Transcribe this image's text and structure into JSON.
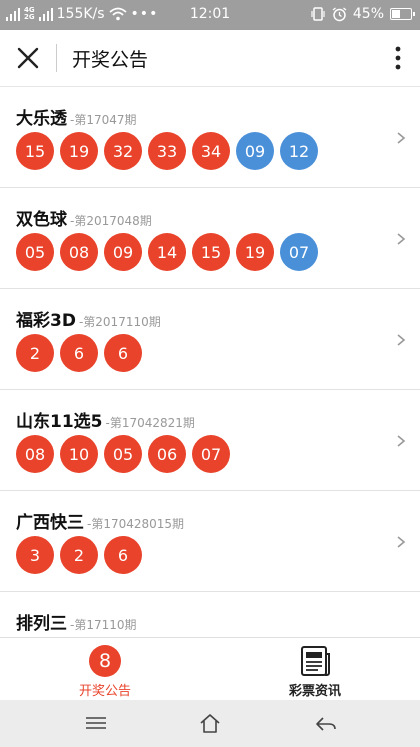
{
  "status_bar": {
    "network_top": "4G",
    "network_bottom": "2G",
    "speed": "155K/s",
    "time": "12:01",
    "battery": "45%",
    "battery_level": 0.45
  },
  "header": {
    "title": "开奖公告"
  },
  "lotteries": [
    {
      "name": "大乐透",
      "issue": "-第17047期",
      "balls": [
        {
          "n": "15",
          "c": "red"
        },
        {
          "n": "19",
          "c": "red"
        },
        {
          "n": "32",
          "c": "red"
        },
        {
          "n": "33",
          "c": "red"
        },
        {
          "n": "34",
          "c": "red"
        },
        {
          "n": "09",
          "c": "blue"
        },
        {
          "n": "12",
          "c": "blue"
        }
      ]
    },
    {
      "name": "双色球",
      "issue": "-第2017048期",
      "balls": [
        {
          "n": "05",
          "c": "red"
        },
        {
          "n": "08",
          "c": "red"
        },
        {
          "n": "09",
          "c": "red"
        },
        {
          "n": "14",
          "c": "red"
        },
        {
          "n": "15",
          "c": "red"
        },
        {
          "n": "19",
          "c": "red"
        },
        {
          "n": "07",
          "c": "blue"
        }
      ]
    },
    {
      "name": "福彩3D",
      "issue": "-第2017110期",
      "balls": [
        {
          "n": "2",
          "c": "red"
        },
        {
          "n": "6",
          "c": "red"
        },
        {
          "n": "6",
          "c": "red"
        }
      ]
    },
    {
      "name": "山东11选5",
      "issue": "-第17042821期",
      "balls": [
        {
          "n": "08",
          "c": "red"
        },
        {
          "n": "10",
          "c": "red"
        },
        {
          "n": "05",
          "c": "red"
        },
        {
          "n": "06",
          "c": "red"
        },
        {
          "n": "07",
          "c": "red"
        }
      ]
    },
    {
      "name": "广西快三",
      "issue": "-第170428015期",
      "balls": [
        {
          "n": "3",
          "c": "red"
        },
        {
          "n": "2",
          "c": "red"
        },
        {
          "n": "6",
          "c": "red"
        }
      ]
    },
    {
      "name": "排列三",
      "issue": "-第17110期",
      "balls": []
    }
  ],
  "tabs": [
    {
      "label": "开奖公告",
      "icon_text": "8",
      "active": true
    },
    {
      "label": "彩票资讯",
      "active": false
    }
  ],
  "colors": {
    "ball_red": "#e9432b",
    "ball_blue": "#4a90d9",
    "accent": "#e9432b"
  }
}
